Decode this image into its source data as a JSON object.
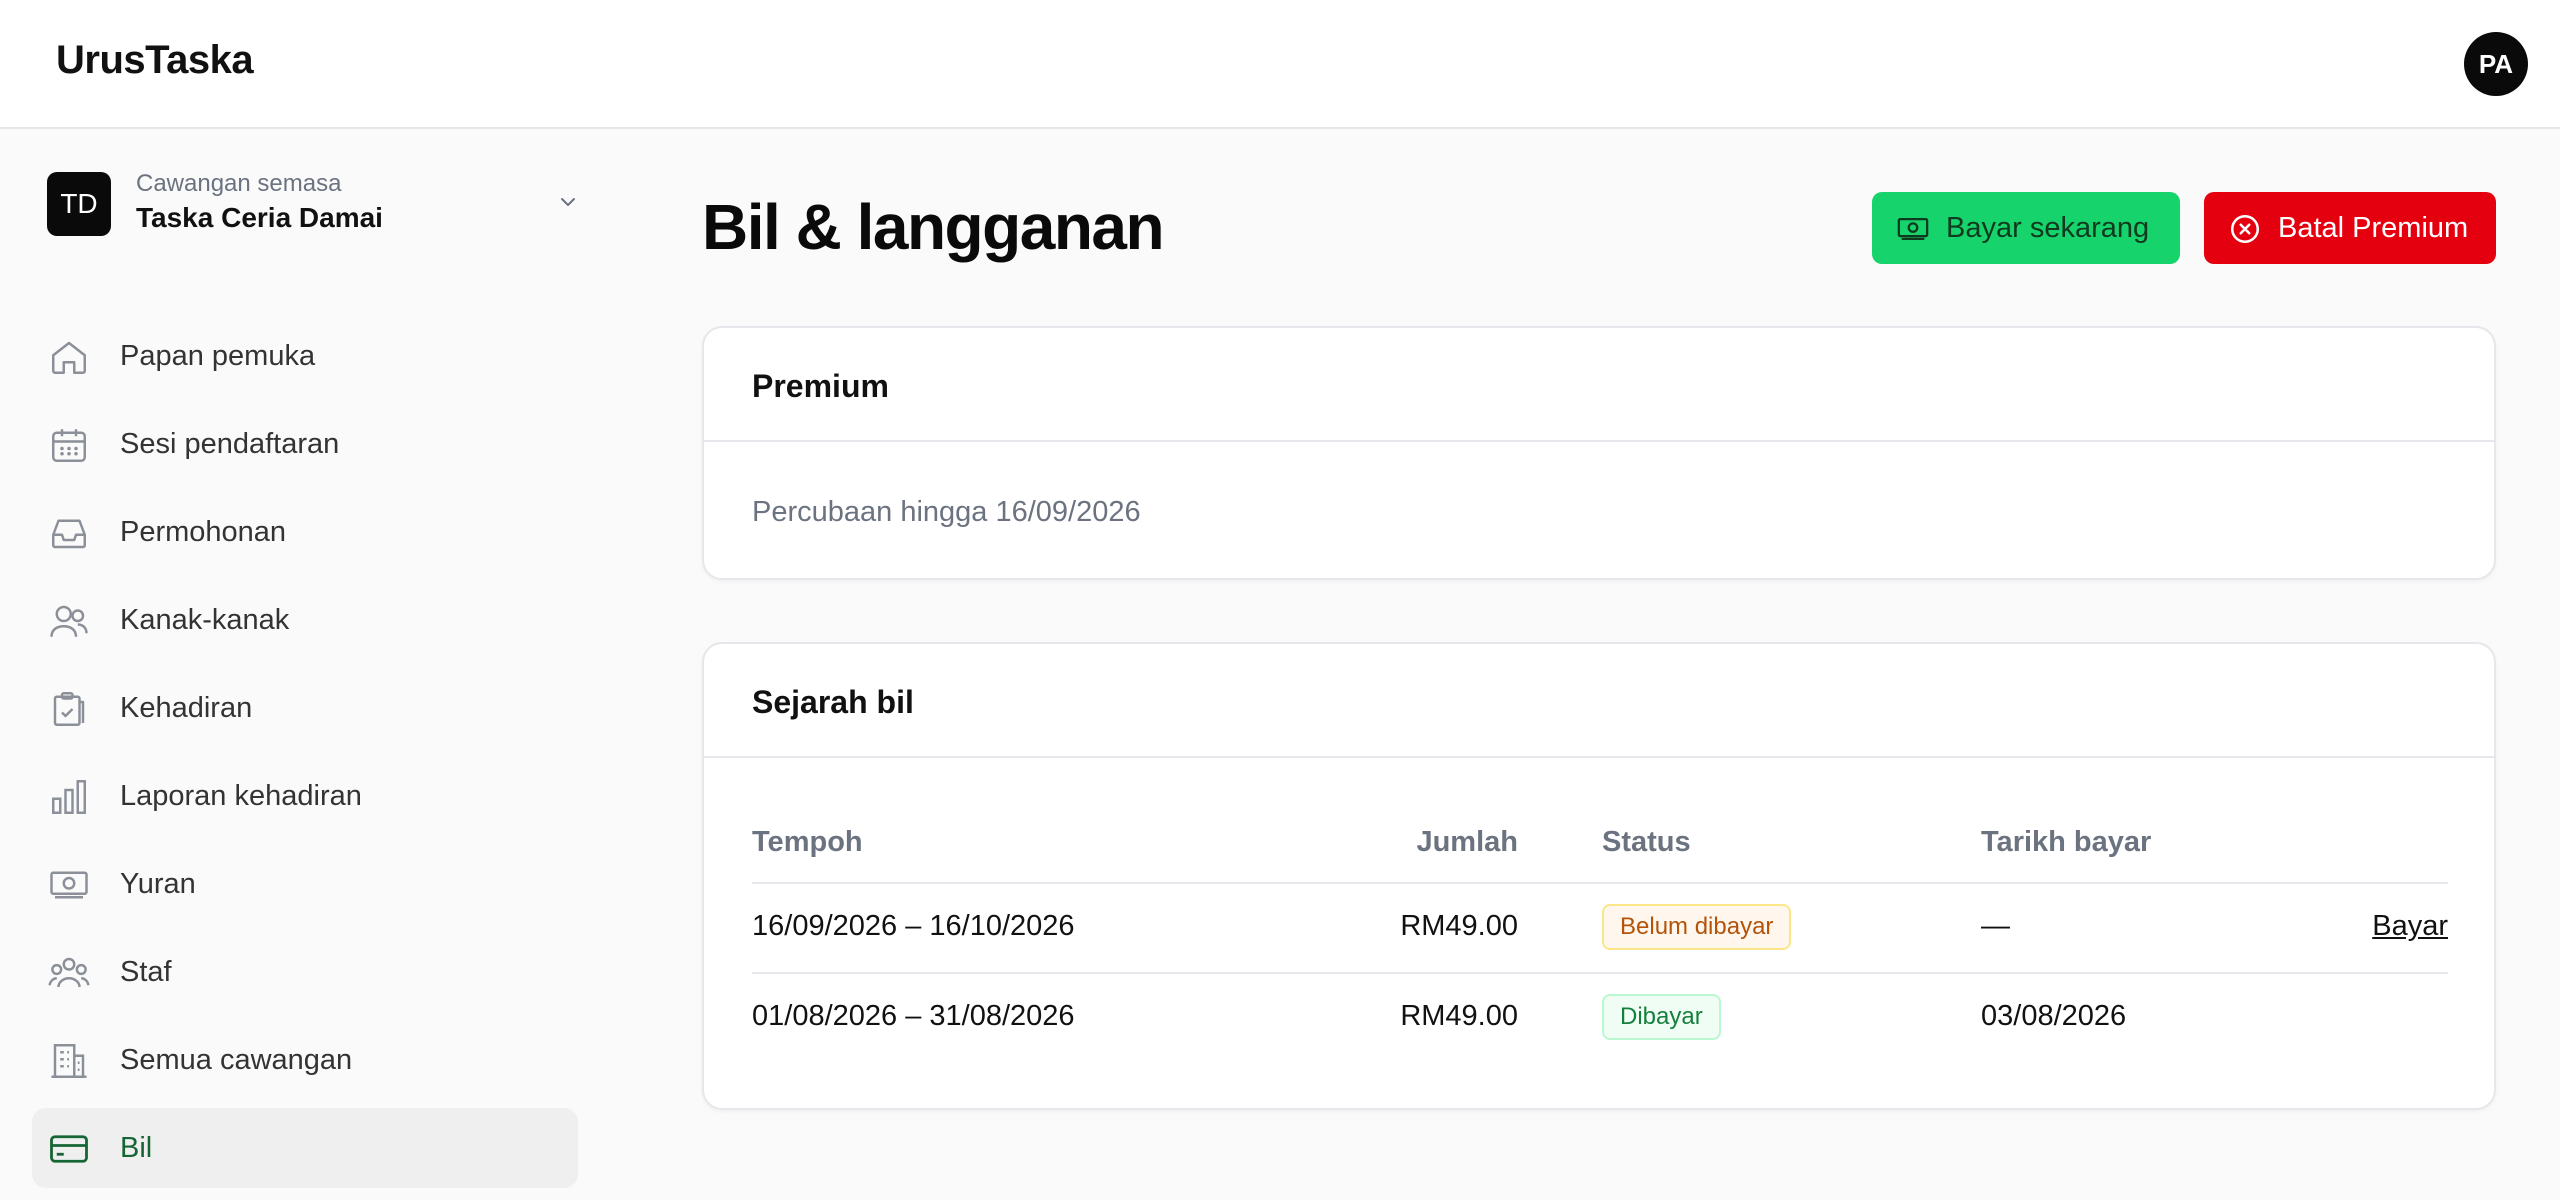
{
  "header": {
    "brand": "UrusTaska",
    "avatar_initials": "PA"
  },
  "branch": {
    "badge": "TD",
    "caption": "Cawangan semasa",
    "name": "Taska Ceria Damai"
  },
  "sidebar": {
    "items": [
      {
        "label": "Papan pemuka",
        "icon": "home-icon"
      },
      {
        "label": "Sesi pendaftaran",
        "icon": "calendar-icon"
      },
      {
        "label": "Permohonan",
        "icon": "inbox-icon"
      },
      {
        "label": "Kanak-kanak",
        "icon": "users-icon"
      },
      {
        "label": "Kehadiran",
        "icon": "clipboard-check-icon"
      },
      {
        "label": "Laporan kehadiran",
        "icon": "bar-chart-icon"
      },
      {
        "label": "Yuran",
        "icon": "banknote-icon"
      },
      {
        "label": "Staf",
        "icon": "team-icon"
      },
      {
        "label": "Semua cawangan",
        "icon": "building-icon"
      },
      {
        "label": "Bil",
        "icon": "credit-card-icon",
        "active": true
      }
    ]
  },
  "page": {
    "title": "Bil & langganan",
    "pay_button": "Bayar sekarang",
    "cancel_button": "Batal Premium"
  },
  "premium": {
    "title": "Premium",
    "trial_text": "Percubaan hingga 16/09/2026"
  },
  "history": {
    "title": "Sejarah bil",
    "columns": {
      "period": "Tempoh",
      "amount": "Jumlah",
      "status": "Status",
      "paid_date": "Tarikh bayar"
    },
    "rows": [
      {
        "period": "16/09/2026 – 16/10/2026",
        "amount": "RM49.00",
        "status": "Belum dibayar",
        "paid_date": "—",
        "action": "Bayar"
      },
      {
        "period": "01/08/2026 – 31/08/2026",
        "amount": "RM49.00",
        "status": "Dibayar",
        "paid_date": "03/08/2026",
        "action": ""
      }
    ]
  },
  "colors": {
    "pay_button": "#16d46b",
    "cancel_button": "#e5000f",
    "active_nav": "#166534"
  }
}
